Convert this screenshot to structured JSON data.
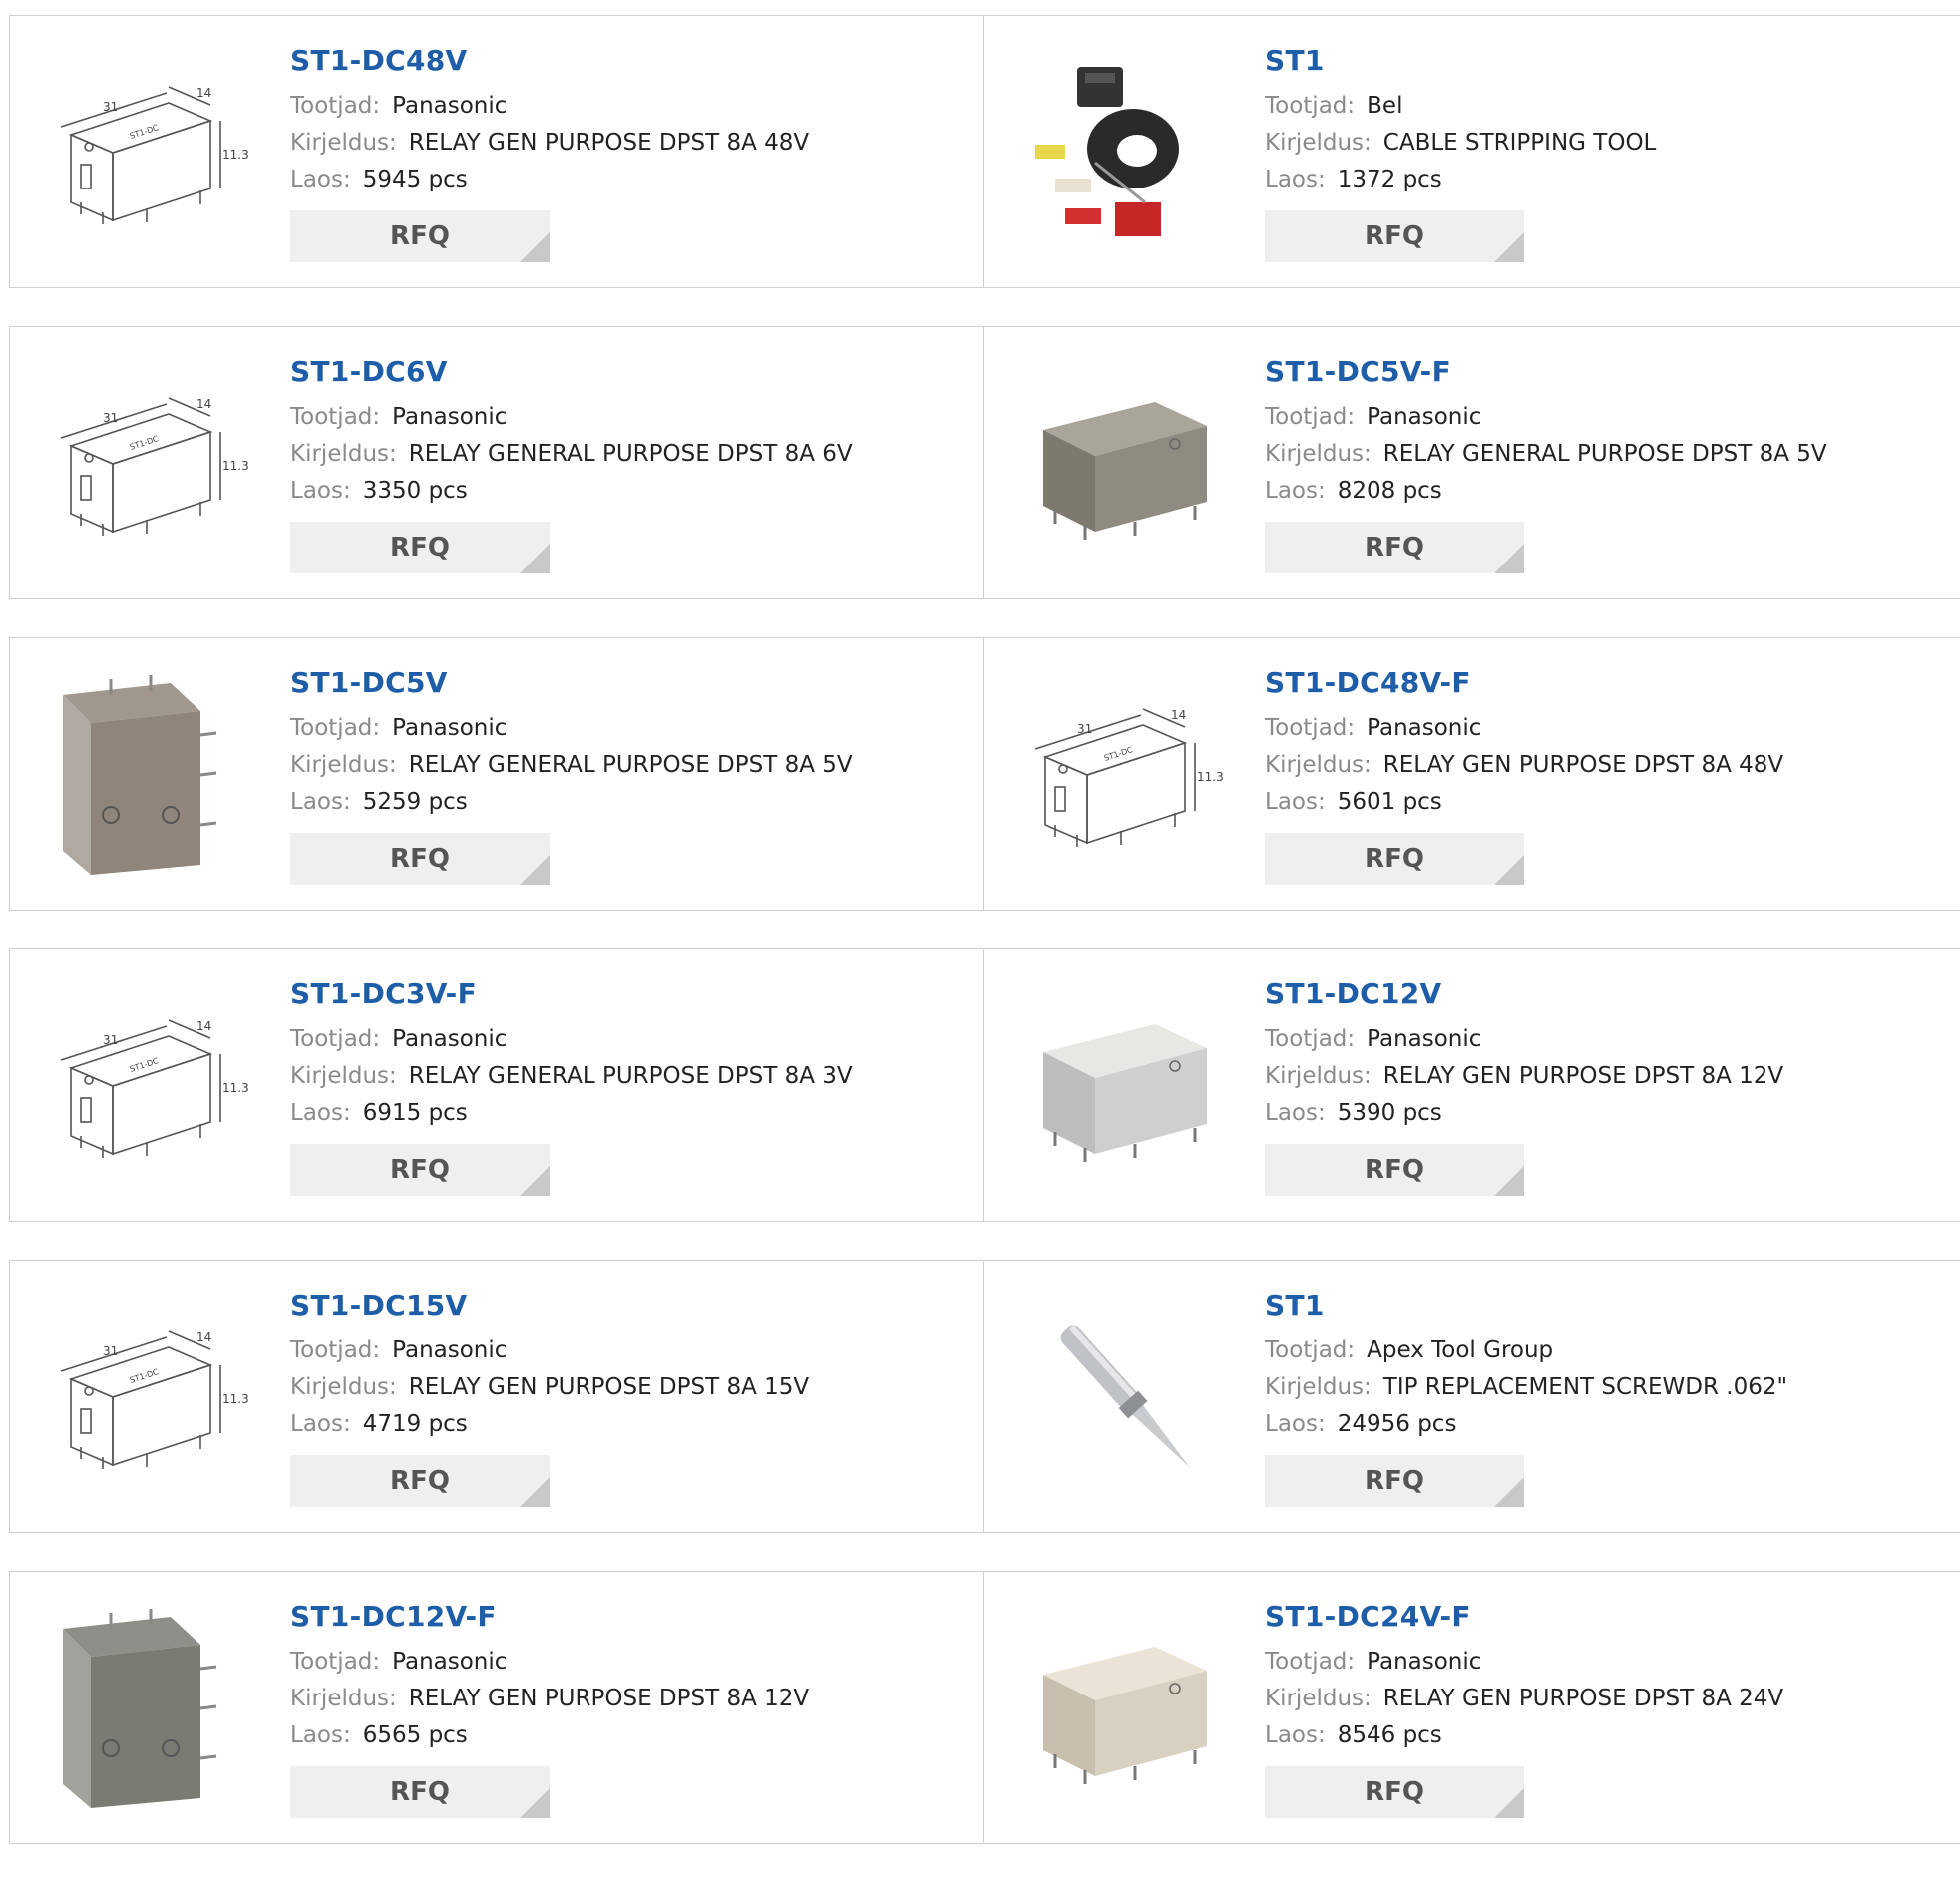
{
  "labels": {
    "maker": "Tootjad:",
    "desc": "Kirjeldus:",
    "stock": "Laos:",
    "rfq": "RFQ"
  },
  "products": [
    {
      "name": "ST1-DC48V",
      "maker": "Panasonic",
      "desc": "RELAY GEN PURPOSE DPST 8A 48V",
      "stock": "5945 pcs",
      "image": "relay-drawing"
    },
    {
      "name": "ST1",
      "maker": "Bel",
      "desc": "CABLE STRIPPING TOOL",
      "stock": "1372 pcs",
      "image": "stripping-tool"
    },
    {
      "name": "ST1-DC6V",
      "maker": "Panasonic",
      "desc": "RELAY GENERAL PURPOSE DPST 8A 6V",
      "stock": "3350 pcs",
      "image": "relay-drawing"
    },
    {
      "name": "ST1-DC5V-F",
      "maker": "Panasonic",
      "desc": "RELAY GENERAL PURPOSE DPST 8A 5V",
      "stock": "8208 pcs",
      "image": "relay-gray"
    },
    {
      "name": "ST1-DC5V",
      "maker": "Panasonic",
      "desc": "RELAY GENERAL PURPOSE DPST 8A 5V",
      "stock": "5259 pcs",
      "image": "relay-brown"
    },
    {
      "name": "ST1-DC48V-F",
      "maker": "Panasonic",
      "desc": "RELAY GEN PURPOSE DPST 8A 48V",
      "stock": "5601 pcs",
      "image": "relay-drawing"
    },
    {
      "name": "ST1-DC3V-F",
      "maker": "Panasonic",
      "desc": "RELAY GENERAL PURPOSE DPST 8A 3V",
      "stock": "6915 pcs",
      "image": "relay-drawing"
    },
    {
      "name": "ST1-DC12V",
      "maker": "Panasonic",
      "desc": "RELAY GEN PURPOSE DPST 8A 12V",
      "stock": "5390 pcs",
      "image": "relay-light"
    },
    {
      "name": "ST1-DC15V",
      "maker": "Panasonic",
      "desc": "RELAY GEN PURPOSE DPST 8A 15V",
      "stock": "4719 pcs",
      "image": "relay-drawing"
    },
    {
      "name": "ST1",
      "maker": "Apex Tool Group",
      "desc": "TIP REPLACEMENT SCREWDR .062\"",
      "stock": "24956 pcs",
      "image": "solder-tip"
    },
    {
      "name": "ST1-DC12V-F",
      "maker": "Panasonic",
      "desc": "RELAY GEN PURPOSE DPST 8A 12V",
      "stock": "6565 pcs",
      "image": "relay-dark"
    },
    {
      "name": "ST1-DC24V-F",
      "maker": "Panasonic",
      "desc": "RELAY GEN PURPOSE DPST 8A 24V",
      "stock": "8546 pcs",
      "image": "relay-beige"
    }
  ]
}
